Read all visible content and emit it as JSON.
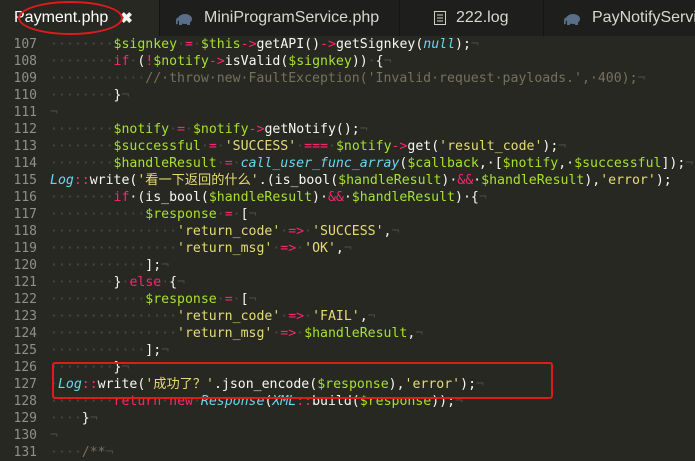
{
  "tabs": [
    {
      "label": "Payment.php",
      "icon": "php-elephant-icon",
      "active": true,
      "close": "✖"
    },
    {
      "label": "MiniProgramService.php",
      "icon": "php-elephant-icon",
      "active": false
    },
    {
      "label": "222.log",
      "icon": "document-icon",
      "active": false
    },
    {
      "label": "PayNotifyServi",
      "icon": "php-elephant-icon",
      "active": false
    }
  ],
  "editor": {
    "lines": [
      {
        "num": "107",
        "tokens": [
          [
            "ws",
            "········"
          ],
          [
            "var",
            "$signkey"
          ],
          [
            "ws",
            "·"
          ],
          [
            "kw",
            "="
          ],
          [
            "ws",
            "·"
          ],
          [
            "var",
            "$this"
          ],
          [
            "kw",
            "->"
          ],
          [
            "pl",
            "getAPI()"
          ],
          [
            "kw",
            "->"
          ],
          [
            "pl",
            "getSignkey("
          ],
          [
            "cls",
            "null"
          ],
          [
            "pl",
            ");"
          ],
          [
            "ws",
            "¬"
          ]
        ]
      },
      {
        "num": "108",
        "tokens": [
          [
            "ws",
            "········"
          ],
          [
            "kw",
            "if"
          ],
          [
            "ws",
            "·"
          ],
          [
            "pl",
            "("
          ],
          [
            "kw",
            "!"
          ],
          [
            "var",
            "$notify"
          ],
          [
            "kw",
            "->"
          ],
          [
            "pl",
            "isValid("
          ],
          [
            "var",
            "$signkey"
          ],
          [
            "pl",
            "))"
          ],
          [
            "ws",
            "·"
          ],
          [
            "pl",
            "{"
          ],
          [
            "ws",
            "¬"
          ]
        ]
      },
      {
        "num": "109",
        "tokens": [
          [
            "ws",
            "············"
          ],
          [
            "cm",
            "//·throw·new·FaultException('Invalid·request·payloads.',·400);"
          ],
          [
            "ws",
            "¬"
          ]
        ]
      },
      {
        "num": "110",
        "tokens": [
          [
            "ws",
            "········"
          ],
          [
            "pl",
            "}"
          ],
          [
            "ws",
            "¬"
          ]
        ]
      },
      {
        "num": "111",
        "tokens": [
          [
            "ws",
            "¬"
          ]
        ]
      },
      {
        "num": "112",
        "tokens": [
          [
            "ws",
            "········"
          ],
          [
            "var",
            "$notify"
          ],
          [
            "ws",
            "·"
          ],
          [
            "kw",
            "="
          ],
          [
            "ws",
            "·"
          ],
          [
            "var",
            "$notify"
          ],
          [
            "kw",
            "->"
          ],
          [
            "pl",
            "getNotify();"
          ],
          [
            "ws",
            "¬"
          ]
        ]
      },
      {
        "num": "113",
        "tokens": [
          [
            "ws",
            "········"
          ],
          [
            "var",
            "$successful"
          ],
          [
            "ws",
            "·"
          ],
          [
            "kw",
            "="
          ],
          [
            "ws",
            "·"
          ],
          [
            "str",
            "'SUCCESS'"
          ],
          [
            "ws",
            "·"
          ],
          [
            "kw",
            "==="
          ],
          [
            "ws",
            "·"
          ],
          [
            "var",
            "$notify"
          ],
          [
            "kw",
            "->"
          ],
          [
            "pl",
            "get("
          ],
          [
            "str",
            "'result_code'"
          ],
          [
            "pl",
            ");"
          ],
          [
            "ws",
            "¬"
          ]
        ]
      },
      {
        "num": "114",
        "tokens": [
          [
            "ws",
            "········"
          ],
          [
            "var",
            "$handleResult"
          ],
          [
            "ws",
            "·"
          ],
          [
            "kw",
            "="
          ],
          [
            "ws",
            "·"
          ],
          [
            "cls",
            "call_user_func_array"
          ],
          [
            "pl",
            "("
          ],
          [
            "var",
            "$callback"
          ],
          [
            "pl",
            ",·["
          ],
          [
            "var",
            "$notify"
          ],
          [
            "pl",
            ",·"
          ],
          [
            "var",
            "$successful"
          ],
          [
            "pl",
            "]);"
          ],
          [
            "ws",
            "¬"
          ]
        ]
      },
      {
        "num": "115",
        "tokens": [
          [
            "cls",
            "Log"
          ],
          [
            "kw",
            "::"
          ],
          [
            "pl",
            "write("
          ],
          [
            "str",
            "'看一下返回的什么'"
          ],
          [
            "pl",
            "."
          ],
          [
            "pl",
            "(is_bool("
          ],
          [
            "var",
            "$handleResult"
          ],
          [
            "pl",
            ")·"
          ],
          [
            "kw",
            "&&"
          ],
          [
            "pl",
            "·"
          ],
          [
            "var",
            "$handleResult"
          ],
          [
            "pl",
            "),"
          ],
          [
            "str",
            "'error'"
          ],
          [
            "pl",
            ");"
          ]
        ]
      },
      {
        "num": "116",
        "tokens": [
          [
            "ws",
            "········"
          ],
          [
            "kw",
            "if"
          ],
          [
            "pl",
            "·(is_bool("
          ],
          [
            "var",
            "$handleResult"
          ],
          [
            "pl",
            ")·"
          ],
          [
            "kw",
            "&&"
          ],
          [
            "pl",
            "·"
          ],
          [
            "var",
            "$handleResult"
          ],
          [
            "pl",
            ")·{"
          ],
          [
            "ws",
            "¬"
          ]
        ]
      },
      {
        "num": "117",
        "tokens": [
          [
            "ws",
            "············"
          ],
          [
            "var",
            "$response"
          ],
          [
            "ws",
            "·"
          ],
          [
            "kw",
            "="
          ],
          [
            "ws",
            "·"
          ],
          [
            "pl",
            "["
          ],
          [
            "ws",
            "¬"
          ]
        ]
      },
      {
        "num": "118",
        "tokens": [
          [
            "ws",
            "················"
          ],
          [
            "str",
            "'return_code'"
          ],
          [
            "ws",
            "·"
          ],
          [
            "kw",
            "=>"
          ],
          [
            "ws",
            "·"
          ],
          [
            "str",
            "'SUCCESS'"
          ],
          [
            "pl",
            ","
          ],
          [
            "ws",
            "¬"
          ]
        ]
      },
      {
        "num": "119",
        "tokens": [
          [
            "ws",
            "················"
          ],
          [
            "str",
            "'return_msg'"
          ],
          [
            "ws",
            "·"
          ],
          [
            "kw",
            "=>"
          ],
          [
            "ws",
            "·"
          ],
          [
            "str",
            "'OK'"
          ],
          [
            "pl",
            ","
          ],
          [
            "ws",
            "¬"
          ]
        ]
      },
      {
        "num": "120",
        "tokens": [
          [
            "ws",
            "············"
          ],
          [
            "pl",
            "];"
          ],
          [
            "ws",
            "¬"
          ]
        ]
      },
      {
        "num": "121",
        "tokens": [
          [
            "ws",
            "········"
          ],
          [
            "pl",
            "}"
          ],
          [
            "ws",
            "·"
          ],
          [
            "kw",
            "else"
          ],
          [
            "ws",
            "·"
          ],
          [
            "pl",
            "{"
          ],
          [
            "ws",
            "¬"
          ]
        ]
      },
      {
        "num": "122",
        "tokens": [
          [
            "ws",
            "············"
          ],
          [
            "var",
            "$response"
          ],
          [
            "ws",
            "·"
          ],
          [
            "kw",
            "="
          ],
          [
            "ws",
            "·"
          ],
          [
            "pl",
            "["
          ],
          [
            "ws",
            "¬"
          ]
        ]
      },
      {
        "num": "123",
        "tokens": [
          [
            "ws",
            "················"
          ],
          [
            "str",
            "'return_code'"
          ],
          [
            "ws",
            "·"
          ],
          [
            "kw",
            "=>"
          ],
          [
            "ws",
            "·"
          ],
          [
            "str",
            "'FAIL'"
          ],
          [
            "pl",
            ","
          ],
          [
            "ws",
            "¬"
          ]
        ]
      },
      {
        "num": "124",
        "tokens": [
          [
            "ws",
            "················"
          ],
          [
            "str",
            "'return_msg'"
          ],
          [
            "ws",
            "·"
          ],
          [
            "kw",
            "=>"
          ],
          [
            "ws",
            "·"
          ],
          [
            "var",
            "$handleResult"
          ],
          [
            "pl",
            ","
          ],
          [
            "ws",
            "¬"
          ]
        ]
      },
      {
        "num": "125",
        "tokens": [
          [
            "ws",
            "············"
          ],
          [
            "pl",
            "];"
          ],
          [
            "ws",
            "¬"
          ]
        ]
      },
      {
        "num": "126",
        "tokens": [
          [
            "ws",
            "········"
          ],
          [
            "pl",
            "}"
          ],
          [
            "ws",
            "¬"
          ]
        ]
      },
      {
        "num": "127",
        "tokens": [
          [
            "ws",
            "·"
          ],
          [
            "cls",
            "Log"
          ],
          [
            "kw",
            "::"
          ],
          [
            "pl",
            "write("
          ],
          [
            "str",
            "'成功了？'"
          ],
          [
            "pl",
            "."
          ],
          [
            "pl",
            "json_encode("
          ],
          [
            "var",
            "$response"
          ],
          [
            "pl",
            "),"
          ],
          [
            "str",
            "'error'"
          ],
          [
            "pl",
            ");"
          ],
          [
            "ws",
            "¬"
          ]
        ]
      },
      {
        "num": "128",
        "tokens": [
          [
            "ws",
            "········"
          ],
          [
            "kw",
            "return"
          ],
          [
            "ws",
            "·"
          ],
          [
            "kw",
            "new"
          ],
          [
            "ws",
            "·"
          ],
          [
            "cls",
            "Response"
          ],
          [
            "pl",
            "("
          ],
          [
            "cls",
            "XML"
          ],
          [
            "kw",
            "::"
          ],
          [
            "pl",
            "build("
          ],
          [
            "var",
            "$response"
          ],
          [
            "pl",
            "));"
          ],
          [
            "ws",
            "¬"
          ]
        ]
      },
      {
        "num": "129",
        "tokens": [
          [
            "ws",
            "····"
          ],
          [
            "pl",
            "}"
          ],
          [
            "ws",
            "¬"
          ]
        ]
      },
      {
        "num": "130",
        "tokens": [
          [
            "ws",
            "¬"
          ]
        ]
      },
      {
        "num": "131",
        "tokens": [
          [
            "ws",
            "····"
          ],
          [
            "cm",
            "/**"
          ],
          [
            "ws",
            "¬"
          ]
        ]
      }
    ]
  }
}
